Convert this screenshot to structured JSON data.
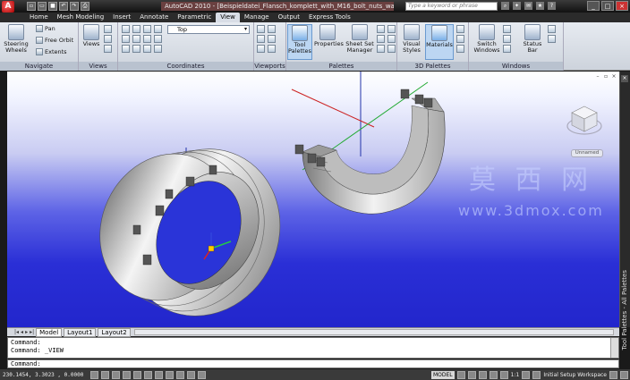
{
  "titlebar": {
    "app_icon": "A",
    "title": "AutoCAD 2010 - [Beispieldatei_Flansch_komplett_with_M16_bolt_nuts_washer.dwg]",
    "search_placeholder": "Type a keyword or phrase",
    "qat_icons": [
      "new-icon",
      "open-icon",
      "save-icon",
      "undo-icon",
      "redo-icon",
      "print-icon"
    ],
    "window_controls": [
      "_",
      "□",
      "×"
    ]
  },
  "ribbon_tabs": [
    "Home",
    "Mesh Modeling",
    "Insert",
    "Annotate",
    "Parametric",
    "View",
    "Manage",
    "Output",
    "Express Tools"
  ],
  "active_tab": "View",
  "ribbon": {
    "navigate": {
      "label": "Navigate",
      "steering": "Steering Wheels",
      "pan": "Pan",
      "free_orbit": "Free Orbit",
      "extents": "Extents"
    },
    "views": {
      "label": "Views",
      "button": "Views"
    },
    "coordinates": {
      "label": "Coordinates",
      "view_select": "Top"
    },
    "viewports": {
      "label": "Viewports"
    },
    "palettes": {
      "label": "Palettes",
      "tool_palettes": "Tool Palettes",
      "properties": "Properties",
      "sheet_set": "Sheet Set Manager"
    },
    "palettes3d": {
      "label": "3D Palettes",
      "visual_styles": "Visual Styles",
      "materials": "Materials"
    },
    "windows": {
      "label": "Windows",
      "switch_windows": "Switch Windows",
      "status_bar": "Status Bar"
    }
  },
  "viewport": {
    "watermark": "莫 西 网",
    "watermark_url": "www.3dmox.com",
    "viewcube_label": "Unnamed",
    "tool_palettes_label": "Tool Palettes - All Palettes"
  },
  "layout_tabs": [
    "Model",
    "Layout1",
    "Layout2"
  ],
  "command": {
    "lines": [
      "Command:",
      "Command: _VIEW"
    ],
    "prompt": "Command:"
  },
  "status": {
    "coords": "230.1454, 3.3023 , 0.0000",
    "model": "MODEL",
    "scale": "1:1",
    "workspace": "Initial Setup Workspace"
  },
  "colors": {
    "viewport_top": "#ffffff",
    "viewport_bottom": "#2226cc",
    "active_tab": "#d8dde6"
  }
}
